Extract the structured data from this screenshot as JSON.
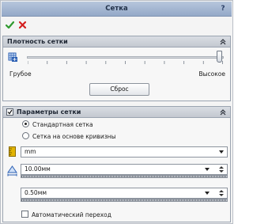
{
  "window": {
    "title": "Сетка",
    "help_label": "?"
  },
  "density": {
    "header": "Плотность сетки",
    "level": 1.0,
    "low_label": "Грубое",
    "high_label": "Высокое",
    "reset_label": "Сброс"
  },
  "params": {
    "header": "Параметры сетки",
    "enabled": true,
    "options": [
      {
        "label": "Стандартная сетка",
        "selected": true
      },
      {
        "label": "Сетка на основе кривизны",
        "selected": false
      }
    ],
    "unit": "mm",
    "size_value": "10.00мм",
    "tolerance_value": "0.50мм",
    "auto_transition_label": "Автоматический переход",
    "auto_transition_checked": false
  },
  "colors": {
    "ok": "#2f9a2f",
    "cancel": "#d42020",
    "title_bar": "#a7b8d2",
    "icon_blue": "#2b5fb3",
    "icon_yellow": "#e2b400"
  },
  "icons": [
    "ok-checkmark-icon",
    "cancel-x-icon",
    "mesh-density-icon",
    "ruler-icon",
    "element-size-icon",
    "collapse-chevrons-icon",
    "help-icon"
  ]
}
